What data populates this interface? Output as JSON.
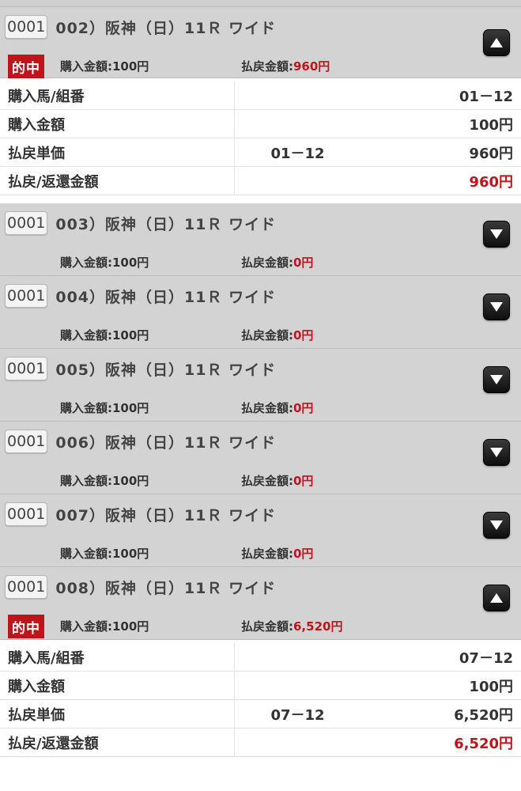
{
  "tickets": [
    {
      "code": "0001",
      "title": "002）阪神（日）11Ｒ ワイド",
      "hit_label": "的中",
      "purchase_label": "購入金額:100円",
      "payout_label": "払戻金額:",
      "payout_value": "960円"
    },
    {
      "code": "0001",
      "title": "003）阪神（日）11Ｒ ワイド",
      "purchase_label": "購入金額:100円",
      "payout_label": "払戻金額:",
      "payout_value": "0円"
    },
    {
      "code": "0001",
      "title": "004）阪神（日）11Ｒ ワイド",
      "purchase_label": "購入金額:100円",
      "payout_label": "払戻金額:",
      "payout_value": "0円"
    },
    {
      "code": "0001",
      "title": "005）阪神（日）11Ｒ ワイド",
      "purchase_label": "購入金額:100円",
      "payout_label": "払戻金額:",
      "payout_value": "0円"
    },
    {
      "code": "0001",
      "title": "006）阪神（日）11Ｒ ワイド",
      "purchase_label": "購入金額:100円",
      "payout_label": "払戻金額:",
      "payout_value": "0円"
    },
    {
      "code": "0001",
      "title": "007）阪神（日）11Ｒ ワイド",
      "purchase_label": "購入金額:100円",
      "payout_label": "払戻金額:",
      "payout_value": "0円"
    },
    {
      "code": "0001",
      "title": "008）阪神（日）11Ｒ ワイド",
      "hit_label": "的中",
      "purchase_label": "購入金額:100円",
      "payout_label": "払戻金額:",
      "payout_value": "6,520円"
    }
  ],
  "details": [
    {
      "horse_label": "購入馬/組番",
      "horse_value": "01－12",
      "amount_label": "購入金額",
      "amount_value": "100円",
      "unit_label": "払戻単価",
      "unit_combo": "01－12",
      "unit_value": "960円",
      "refund_label": "払戻/返還金額",
      "refund_value": "960円"
    },
    {
      "horse_label": "購入馬/組番",
      "horse_value": "07－12",
      "amount_label": "購入金額",
      "amount_value": "100円",
      "unit_label": "払戻単価",
      "unit_combo": "07－12",
      "unit_value": "6,520円",
      "refund_label": "払戻/返還金額",
      "refund_value": "6,520円"
    }
  ],
  "icons": {
    "expanded": "triangle-up-icon",
    "collapsed": "triangle-down-icon"
  },
  "colors": {
    "accent_red": "#c0141a",
    "header_gray": "#d3d3d3"
  }
}
